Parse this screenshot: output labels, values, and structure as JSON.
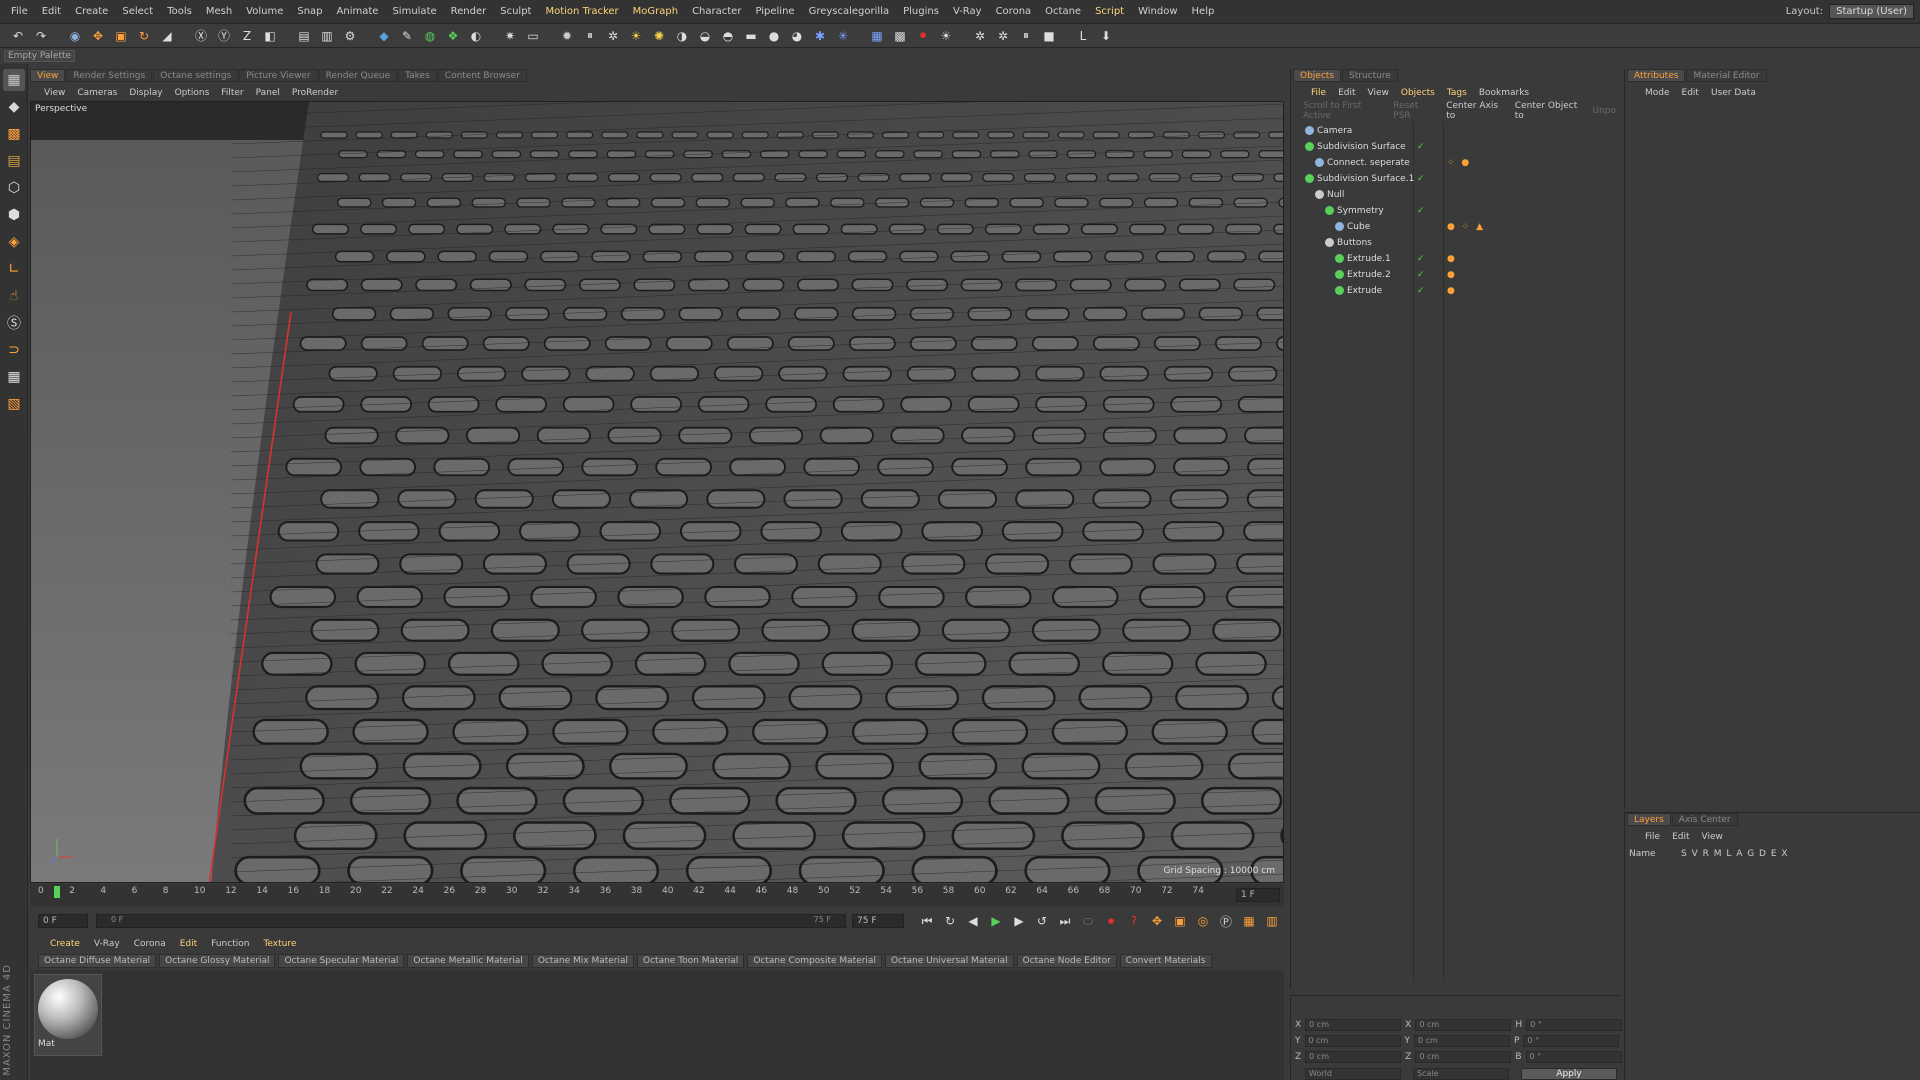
{
  "menubar": {
    "items": [
      {
        "label": "File",
        "hl": false
      },
      {
        "label": "Edit",
        "hl": false
      },
      {
        "label": "Create",
        "hl": false
      },
      {
        "label": "Select",
        "hl": false
      },
      {
        "label": "Tools",
        "hl": false
      },
      {
        "label": "Mesh",
        "hl": false
      },
      {
        "label": "Volume",
        "hl": false
      },
      {
        "label": "Snap",
        "hl": false
      },
      {
        "label": "Animate",
        "hl": false
      },
      {
        "label": "Simulate",
        "hl": false
      },
      {
        "label": "Render",
        "hl": false
      },
      {
        "label": "Sculpt",
        "hl": false
      },
      {
        "label": "Motion Tracker",
        "hl": true
      },
      {
        "label": "MoGraph",
        "hl": true
      },
      {
        "label": "Character",
        "hl": false
      },
      {
        "label": "Pipeline",
        "hl": false
      },
      {
        "label": "Greyscalegorilla",
        "hl": false
      },
      {
        "label": "Plugins",
        "hl": false
      },
      {
        "label": "V-Ray",
        "hl": false
      },
      {
        "label": "Corona",
        "hl": false
      },
      {
        "label": "Octane",
        "hl": false
      },
      {
        "label": "Script",
        "hl": true
      },
      {
        "label": "Window",
        "hl": false
      },
      {
        "label": "Help",
        "hl": false
      }
    ],
    "layout_label": "Layout:",
    "layout_value": "Startup (User)"
  },
  "toolbar": {
    "icons": [
      "undo-icon",
      "redo-icon",
      "sep",
      "live-select-icon",
      "move-icon",
      "scale-icon",
      "rotate-icon",
      "recent-tool-icon",
      "sep",
      "x-axis-icon",
      "y-axis-icon",
      "z-axis-icon",
      "coordinate-system-icon",
      "sep",
      "render-view-icon",
      "render-picture-viewer-icon",
      "render-settings-icon",
      "sep",
      "cube-icon",
      "pen-icon",
      "subdivision-icon",
      "array-icon",
      "deformer-icon",
      "sep",
      "scene-icon",
      "camera-icon",
      "sep",
      "octane-icon",
      "pause-icon",
      "gear-icon",
      "sun-icon",
      "light-icon",
      "sky-icon",
      "sphere-icon",
      "globe-icon",
      "rect-icon",
      "ball-icon",
      "dark-ball-icon",
      "star-icon",
      "star2-icon",
      "sep",
      "grid-icon",
      "film-icon",
      "record-icon",
      "bulb-icon",
      "sep",
      "settings-icon",
      "settings2-icon",
      "pause2-icon",
      "stop-icon",
      "sep",
      "l0-icon",
      "download-icon"
    ]
  },
  "palette_label": "Empty Palette",
  "view_tabs": [
    {
      "label": "View",
      "active": true
    },
    {
      "label": "Render Settings",
      "active": false
    },
    {
      "label": "Octane settings",
      "active": false
    },
    {
      "label": "Picture Viewer",
      "active": false
    },
    {
      "label": "Render Queue",
      "active": false
    },
    {
      "label": "Takes",
      "active": false
    },
    {
      "label": "Content Browser",
      "active": false
    }
  ],
  "view_menu": [
    "View",
    "Cameras",
    "Display",
    "Options",
    "Filter",
    "Panel",
    "ProRender"
  ],
  "viewport": {
    "label": "Perspective",
    "grid_spacing": "Grid Spacing : 10000 cm"
  },
  "timeline": {
    "ticks": [
      "0",
      "2",
      "4",
      "6",
      "8",
      "10",
      "12",
      "14",
      "16",
      "18",
      "20",
      "22",
      "24",
      "26",
      "28",
      "30",
      "32",
      "34",
      "36",
      "38",
      "40",
      "42",
      "44",
      "46",
      "48",
      "50",
      "52",
      "54",
      "56",
      "58",
      "60",
      "62",
      "64",
      "66",
      "68",
      "70",
      "72",
      "74"
    ],
    "current_frame": "1 F",
    "start_field": "0 F",
    "range_start": "0 F",
    "range_end": "75 F",
    "end_field": "75 F"
  },
  "material_menu": [
    "Create",
    "V-Ray",
    "Corona",
    "Edit",
    "Function",
    "Texture"
  ],
  "material_buttons": [
    "Octane Diffuse Material",
    "Octane Glossy Material",
    "Octane Specular Material",
    "Octane Metallic Material",
    "Octane Mix Material",
    "Octane Toon Material",
    "Octane Composite Material",
    "Octane Universal Material",
    "Octane Node Editor",
    "Convert Materials"
  ],
  "material": {
    "name": "Mat"
  },
  "objects_panel": {
    "tabs": [
      {
        "label": "Objects",
        "active": true
      },
      {
        "label": "Structure",
        "active": false
      }
    ],
    "menu": [
      {
        "label": "File",
        "hl": true
      },
      {
        "label": "Edit",
        "hl": false
      },
      {
        "label": "View",
        "hl": false
      },
      {
        "label": "Objects",
        "hl": true
      },
      {
        "label": "Tags",
        "hl": true
      },
      {
        "label": "Bookmarks",
        "hl": false
      }
    ],
    "buttons": [
      {
        "label": "Scroll to First Active",
        "dim": true
      },
      {
        "label": "Reset PSR",
        "dim": true
      },
      {
        "label": "Center Axis to",
        "dim": false
      },
      {
        "label": "Center Object to",
        "dim": false
      },
      {
        "label": "Unpo",
        "dim": true
      }
    ],
    "objects": [
      {
        "name": "Camera",
        "indent": 0,
        "color": "#8fb4e0",
        "flags": "",
        "tags": ""
      },
      {
        "name": "Subdivision Surface",
        "indent": 0,
        "color": "#58d05a",
        "flags": "✓",
        "tags": ""
      },
      {
        "name": "Connect. seperate",
        "indent": 1,
        "color": "#8fb4e0",
        "flags": "",
        "tags": "⁘ ●"
      },
      {
        "name": "Subdivision Surface.1",
        "indent": 0,
        "color": "#58d05a",
        "flags": "✓",
        "tags": ""
      },
      {
        "name": "Null",
        "indent": 1,
        "color": "#cccccc",
        "flags": "",
        "tags": ""
      },
      {
        "name": "Symmetry",
        "indent": 2,
        "color": "#58d05a",
        "flags": "✓",
        "tags": ""
      },
      {
        "name": "Cube",
        "indent": 3,
        "color": "#8fb4e0",
        "flags": "",
        "tags": "● ⁘ ▲"
      },
      {
        "name": "Buttons",
        "indent": 2,
        "color": "#cccccc",
        "flags": "",
        "tags": ""
      },
      {
        "name": "Extrude.1",
        "indent": 3,
        "color": "#58d05a",
        "flags": "✓",
        "tags": "●"
      },
      {
        "name": "Extrude.2",
        "indent": 3,
        "color": "#58d05a",
        "flags": "✓",
        "tags": "●"
      },
      {
        "name": "Extrude",
        "indent": 3,
        "color": "#58d05a",
        "flags": "✓",
        "tags": "●"
      }
    ]
  },
  "attributes_panel": {
    "tabs": [
      {
        "label": "Attributes",
        "active": true
      },
      {
        "label": "Material Editor",
        "active": false
      }
    ],
    "menu": [
      "Mode",
      "Edit",
      "User Data"
    ]
  },
  "layers_panel": {
    "tabs": [
      {
        "label": "Layers",
        "active": true
      },
      {
        "label": "Axis Center",
        "active": false
      }
    ],
    "menu": [
      "File",
      "Edit",
      "View"
    ],
    "header_name": "Name",
    "header_flags": "S V R M L A G D E X"
  },
  "coordinates": {
    "rows": [
      {
        "a": "X",
        "av": "0 cm",
        "b": "X",
        "bv": "0 cm",
        "c": "H",
        "cv": "0 °"
      },
      {
        "a": "Y",
        "av": "0 cm",
        "b": "Y",
        "bv": "0 cm",
        "c": "P",
        "cv": "0 °"
      },
      {
        "a": "Z",
        "av": "0 cm",
        "b": "Z",
        "bv": "0 cm",
        "c": "B",
        "cv": "0 °"
      }
    ],
    "mode1": "World",
    "mode2": "Scale",
    "apply": "Apply"
  },
  "logo_text": "MAXON CINEMA 4D"
}
